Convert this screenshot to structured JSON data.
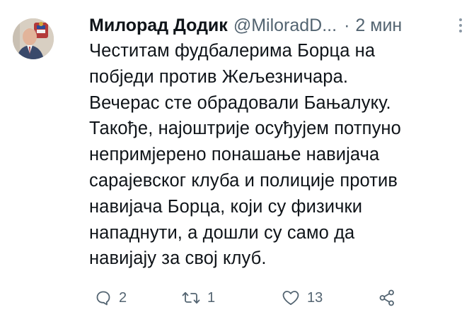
{
  "tweet": {
    "author": {
      "display_name": "Милорад Додик",
      "handle": "@MiloradD...",
      "avatar_icon": "avatar-photo"
    },
    "separator": "·",
    "time": "2 мин",
    "text_lines": [
      "Честитам фудбалерима Борца на",
      "побједи против Жељезничара.",
      "Вечерас сте обрадовали Бањалуку.",
      "Такође, најоштрије осуђујем потпуно",
      "непримјерено понашање навијача",
      "сарајевског клуба и полиције против",
      "навијача Борца, који су физички",
      "нападнути, а дошли су само да",
      "навијају за свој клуб."
    ],
    "actions": {
      "reply": {
        "icon": "reply-icon",
        "count": "2"
      },
      "retweet": {
        "icon": "retweet-icon",
        "count": "1"
      },
      "like": {
        "icon": "heart-icon",
        "count": "13"
      },
      "share": {
        "icon": "share-icon"
      }
    },
    "colors": {
      "text": "#0f1419",
      "secondary": "#536471",
      "background": "#ffffff"
    }
  }
}
